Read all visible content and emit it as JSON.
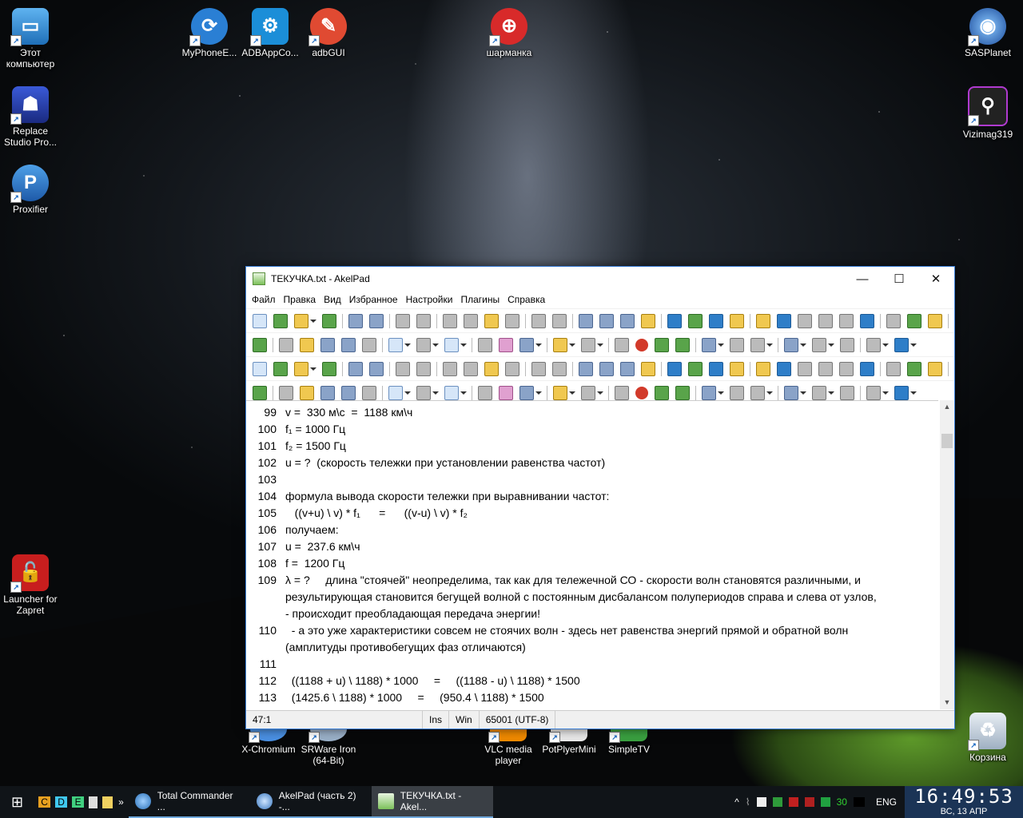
{
  "desktop": {
    "icons": [
      {
        "label": "Этот компьютер",
        "icon": "computer-icon"
      },
      {
        "label": "Replace Studio Pro...",
        "icon": "replace-studio-icon"
      },
      {
        "label": "Proxifier",
        "icon": "proxifier-icon"
      },
      {
        "label": "Launcher for Zapret",
        "icon": "zapret-icon"
      },
      {
        "label": "MyPhoneE...",
        "icon": "myphone-icon"
      },
      {
        "label": "ADBAppCo...",
        "icon": "android-icon"
      },
      {
        "label": "adbGUI",
        "icon": "adbgui-icon"
      },
      {
        "label": "шарманка",
        "icon": "sharmanka-icon"
      },
      {
        "label": "SASPlanet",
        "icon": "sasplanet-icon"
      },
      {
        "label": "Vizimag319",
        "icon": "vizimag-icon"
      },
      {
        "label": "X-Chromium",
        "icon": "chromium-icon"
      },
      {
        "label": "SRWare Iron (64-Bit)",
        "icon": "iron-icon"
      },
      {
        "label": "VLC media player",
        "icon": "vlc-icon"
      },
      {
        "label": "PotPlyerMini",
        "icon": "potplayer-icon"
      },
      {
        "label": "SimpleTV",
        "icon": "simpletv-icon"
      },
      {
        "label": "Корзина",
        "icon": "recycle-bin-icon"
      }
    ]
  },
  "window": {
    "title": "ТЕКУЧКА.txt - AkelPad",
    "controls": {
      "minimize": "—",
      "maximize": "☐",
      "close": "✕"
    },
    "menu": [
      "Файл",
      "Правка",
      "Вид",
      "Избранное",
      "Настройки",
      "Плагины",
      "Справка"
    ],
    "lines": [
      {
        "num": "99",
        "text": "v =  330 м\\с  =  1188 км\\ч"
      },
      {
        "num": "100",
        "text": "f₁ = 1000 Гц"
      },
      {
        "num": "101",
        "text": "f₂ = 1500 Гц"
      },
      {
        "num": "102",
        "text": "u = ?  (скорость тележки при установлении равенства частот)"
      },
      {
        "num": "103",
        "text": ""
      },
      {
        "num": "104",
        "text": "формула вывода скорости тележки при выравнивании частот:"
      },
      {
        "num": "105",
        "text": "   ((v+u) \\ v) * f₁      =      ((v-u) \\ v) * f₂"
      },
      {
        "num": "106",
        "text": "получаем:"
      },
      {
        "num": "107",
        "text": "u =  237.6 км\\ч"
      },
      {
        "num": "108",
        "text": "f =  1200 Гц"
      },
      {
        "num": "109",
        "text": "λ = ?     длина \"стоячей\" неопределима, так как для тележечной СО - скорости волн становятся различными, и"
      },
      {
        "num": "",
        "text": "результирующая становится бегущей волной с постоянным дисбалансом полупериодов справа и слева от узлов,"
      },
      {
        "num": "",
        "text": "- происходит преобладающая передача энергии!"
      },
      {
        "num": "110",
        "text": "  - а это уже характеристики совсем не стоячих волн - здесь нет равенства энергий прямой и обратной волн"
      },
      {
        "num": "",
        "text": "(амплитуды противобегущих фаз отличаются)"
      },
      {
        "num": "111",
        "text": ""
      },
      {
        "num": "112",
        "text": "  ((1188 + u) \\ 1188) * 1000     =     ((1188 - u) \\ 1188) * 1500"
      },
      {
        "num": "113",
        "text": "  (1425.6 \\ 1188) * 1000     =     (950.4 \\ 1188) * 1500"
      }
    ],
    "status": {
      "position": "47:1",
      "mode": "Ins",
      "newline": "Win",
      "encoding": "65001 (UTF-8)"
    }
  },
  "taskbar": {
    "tasks": [
      {
        "label": "Total Commander ...",
        "active": false
      },
      {
        "label": "AkelPad (часть 2) -...",
        "active": false
      },
      {
        "label": "ТЕКУЧКА.txt - Akel...",
        "active": true
      }
    ],
    "quick": [
      "C",
      "D",
      "E"
    ],
    "tray_number": "30",
    "language": "ENG",
    "time": "16:49:53",
    "date": "ВС, 13  АПР"
  }
}
